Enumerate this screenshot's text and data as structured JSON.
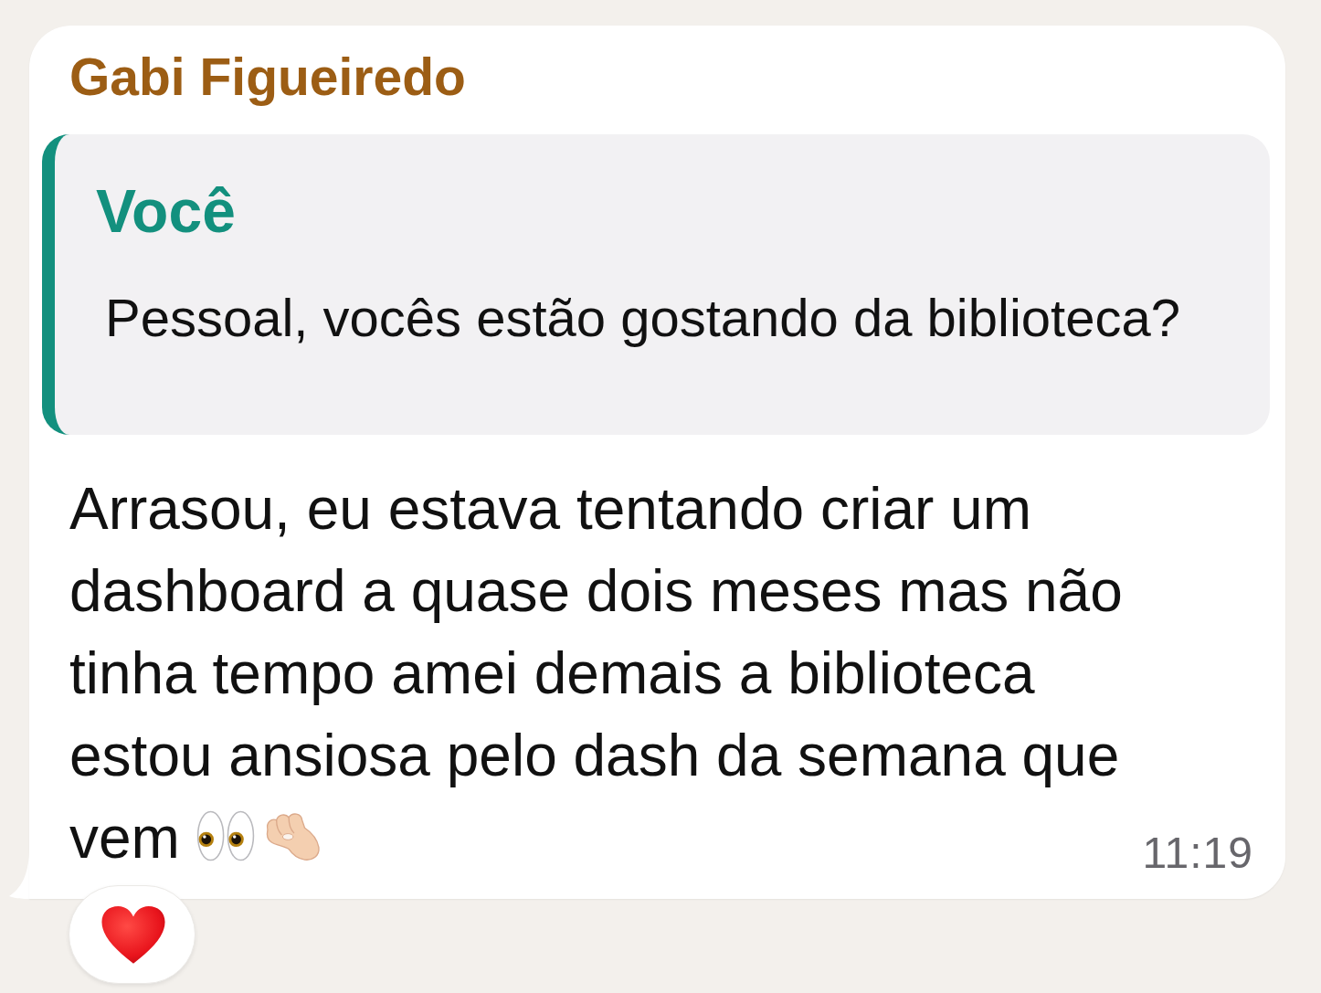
{
  "message": {
    "sender": "Gabi Figueiredo",
    "quoted": {
      "author": "Você",
      "text": "Pessoal, vocês estão gostando da biblioteca?"
    },
    "text": "Arrasou, eu estava tentando criar um dashboard a quase dois meses mas não tinha tempo amei demais a biblioteca estou ansiosa pelo dash da semana que vem",
    "time": "11:19"
  }
}
